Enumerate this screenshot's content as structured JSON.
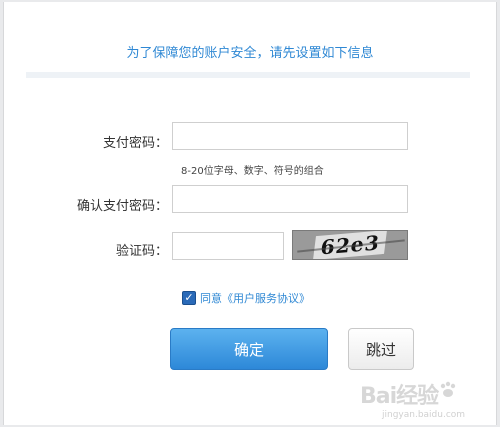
{
  "dialog": {
    "header_title": "为了保障您的账户安全，请先设置如下信息"
  },
  "form": {
    "pay_password": {
      "label": "支付密码：",
      "value": "",
      "hint": "8-20位字母、数字、符号的组合"
    },
    "confirm_password": {
      "label": "确认支付密码：",
      "value": ""
    },
    "captcha": {
      "label": "验证码：",
      "value": "",
      "image_text": "62e3"
    },
    "agreement": {
      "checked": true,
      "text": "同意《用户服务协议》"
    }
  },
  "buttons": {
    "confirm_label": "确定",
    "skip_label": "跳过"
  },
  "watermark": {
    "main": "Bai经验",
    "sub": "jingyan.baidu.com"
  },
  "colors": {
    "accent": "#2f88d4",
    "confirm_button": "#3a93dd",
    "checkbox": "#2a6ab8"
  }
}
